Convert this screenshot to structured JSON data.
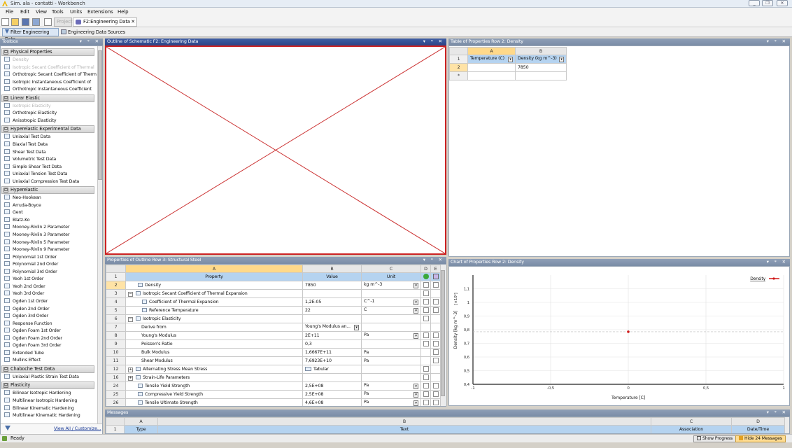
{
  "window": {
    "title": "Sim. ala - contatti - Workbench",
    "buttons": [
      "_",
      "❐",
      "✕"
    ]
  },
  "menu": [
    "File",
    "Edit",
    "View",
    "Tools",
    "Units",
    "Extensions",
    "Help"
  ],
  "tabs": {
    "project": "Project",
    "engineering": "F2:Engineering Data",
    "close": "✕"
  },
  "toolbar2": {
    "filter": "Filter Engineering Data",
    "sources": "Engineering Data Sources"
  },
  "toolbox": {
    "title": "Toolbox",
    "controls": "▾ ᵠ ✕",
    "groups": [
      {
        "label": "Physical Properties",
        "items": [
          {
            "label": "Density",
            "disabled": true
          },
          {
            "label": "Isotropic Secant Coefficient of Thermal",
            "disabled": true
          },
          {
            "label": "Orthotropic Secant Coefficient of Therm",
            "disabled": false
          },
          {
            "label": "Isotropic Instantaneous Coefficient of",
            "disabled": false
          },
          {
            "label": "Orthotropic Instantaneous Coefficient",
            "disabled": false
          }
        ]
      },
      {
        "label": "Linear Elastic",
        "items": [
          {
            "label": "Isotropic Elasticity",
            "disabled": true
          },
          {
            "label": "Orthotropic Elasticity",
            "disabled": false
          },
          {
            "label": "Anisotropic Elasticity",
            "disabled": false
          }
        ]
      },
      {
        "label": "Hyperelastic Experimental Data",
        "items": [
          {
            "label": "Uniaxial Test Data",
            "disabled": false
          },
          {
            "label": "Biaxial Test Data",
            "disabled": false
          },
          {
            "label": "Shear Test Data",
            "disabled": false
          },
          {
            "label": "Volumetric Test Data",
            "disabled": false
          },
          {
            "label": "Simple Shear Test Data",
            "disabled": false
          },
          {
            "label": "Uniaxial Tension Test Data",
            "disabled": false
          },
          {
            "label": "Uniaxial Compression Test Data",
            "disabled": false
          }
        ]
      },
      {
        "label": "Hyperelastic",
        "items": [
          {
            "label": "Neo-Hookean",
            "disabled": false
          },
          {
            "label": "Arruda-Boyce",
            "disabled": false
          },
          {
            "label": "Gent",
            "disabled": false
          },
          {
            "label": "Blatz-Ko",
            "disabled": false
          },
          {
            "label": "Mooney-Rivlin 2 Parameter",
            "disabled": false
          },
          {
            "label": "Mooney-Rivlin 3 Parameter",
            "disabled": false
          },
          {
            "label": "Mooney-Rivlin 5 Parameter",
            "disabled": false
          },
          {
            "label": "Mooney-Rivlin 9 Parameter",
            "disabled": false
          },
          {
            "label": "Polynomial 1st Order",
            "disabled": false
          },
          {
            "label": "Polynomial 2nd Order",
            "disabled": false
          },
          {
            "label": "Polynomial 3rd Order",
            "disabled": false
          },
          {
            "label": "Yeoh 1st Order",
            "disabled": false
          },
          {
            "label": "Yeoh 2nd Order",
            "disabled": false
          },
          {
            "label": "Yeoh 3rd Order",
            "disabled": false
          },
          {
            "label": "Ogden 1st Order",
            "disabled": false
          },
          {
            "label": "Ogden 2nd Order",
            "disabled": false
          },
          {
            "label": "Ogden 3rd Order",
            "disabled": false
          },
          {
            "label": "Response Function",
            "disabled": false
          },
          {
            "label": "Ogden Foam 1st Order",
            "disabled": false
          },
          {
            "label": "Ogden Foam 2nd Order",
            "disabled": false
          },
          {
            "label": "Ogden Foam 3rd Order",
            "disabled": false
          },
          {
            "label": "Extended Tube",
            "disabled": false
          },
          {
            "label": "Mullins Effect",
            "disabled": false
          }
        ]
      },
      {
        "label": "Chaboche Test Data",
        "items": [
          {
            "label": "Uniaxial Plastic Strain Test Data",
            "disabled": false
          }
        ]
      },
      {
        "label": "Plasticity",
        "items": [
          {
            "label": "Bilinear Isotropic Hardening",
            "disabled": false
          },
          {
            "label": "Multilinear Isotropic Hardening",
            "disabled": false
          },
          {
            "label": "Bilinear Kinematic Hardening",
            "disabled": false
          },
          {
            "label": "Multilinear Kinematic Hardening",
            "disabled": false
          }
        ]
      }
    ],
    "view_all": "View All / Customize..."
  },
  "outline": {
    "title": "Outline of Schematic F2: Engineering Data",
    "controls": "▾ ᵠ ✕"
  },
  "table_props": {
    "title": "Table of Properties Row 2: Density",
    "controls": "▾ ᵠ ✕",
    "col_letters": [
      "A",
      "B"
    ],
    "headers": [
      "Temperature (C)",
      "Density (kg m^-3)"
    ],
    "rows": [
      [
        "1",
        "",
        ""
      ],
      [
        "2",
        "",
        "7850"
      ],
      [
        "*",
        "",
        ""
      ]
    ]
  },
  "properties": {
    "title": "Properties of Outline Row 3: Structural Steel",
    "controls": "▾ ᵠ ✕",
    "col_letters": [
      "A",
      "B",
      "C",
      "D",
      "E"
    ],
    "headers": [
      "Property",
      "Value",
      "Unit"
    ],
    "rows": [
      {
        "n": "2",
        "label": "Density",
        "indent": 0,
        "exp": "",
        "icon": true,
        "value": "7850",
        "unit": "kg m^-3",
        "dd": true,
        "d": true,
        "e": true
      },
      {
        "n": "3",
        "label": "Isotropic Secant Coefficient of Thermal Expansion",
        "indent": 0,
        "exp": "⊟",
        "icon": true,
        "value": "",
        "unit": "",
        "dd": false,
        "d": true,
        "e": false
      },
      {
        "n": "4",
        "label": "Coefficient of Thermal Expansion",
        "indent": 1,
        "exp": "",
        "icon": true,
        "value": "1,2E-05",
        "unit": "C^-1",
        "dd": true,
        "d": true,
        "e": true
      },
      {
        "n": "5",
        "label": "Reference Temperature",
        "indent": 1,
        "exp": "",
        "icon": true,
        "value": "22",
        "unit": "C",
        "dd": true,
        "d": true,
        "e": true
      },
      {
        "n": "6",
        "label": "Isotropic Elasticity",
        "indent": 0,
        "exp": "⊟",
        "icon": true,
        "value": "",
        "unit": "",
        "dd": false,
        "d": true,
        "e": false
      },
      {
        "n": "7",
        "label": "Derive from",
        "indent": 1,
        "exp": "",
        "icon": false,
        "value": "Young's Modulus an...",
        "unit": "",
        "dd": false,
        "d": false,
        "e": false,
        "vdd": true
      },
      {
        "n": "8",
        "label": "Young's Modulus",
        "indent": 1,
        "exp": "",
        "icon": false,
        "value": "2E+11",
        "unit": "Pa",
        "dd": true,
        "d": true,
        "e": true
      },
      {
        "n": "9",
        "label": "Poisson's Ratio",
        "indent": 1,
        "exp": "",
        "icon": false,
        "value": "0,3",
        "unit": "",
        "dd": false,
        "d": true,
        "e": true
      },
      {
        "n": "10",
        "label": "Bulk Modulus",
        "indent": 1,
        "exp": "",
        "icon": false,
        "value": "1,6667E+11",
        "unit": "Pa",
        "dd": false,
        "d": false,
        "e": true
      },
      {
        "n": "11",
        "label": "Shear Modulus",
        "indent": 1,
        "exp": "",
        "icon": false,
        "value": "7,6923E+10",
        "unit": "Pa",
        "dd": false,
        "d": false,
        "e": true
      },
      {
        "n": "12",
        "label": "Alternating Stress Mean Stress",
        "indent": 0,
        "exp": "⊞",
        "icon": true,
        "value": "Tabular",
        "unit": "",
        "dd": false,
        "d": true,
        "e": false,
        "vicon": true
      },
      {
        "n": "16",
        "label": "Strain-Life Parameters",
        "indent": 0,
        "exp": "⊞",
        "icon": true,
        "value": "",
        "unit": "",
        "dd": false,
        "d": true,
        "e": false
      },
      {
        "n": "24",
        "label": "Tensile Yield Strength",
        "indent": 0,
        "exp": "",
        "icon": true,
        "value": "2,5E+08",
        "unit": "Pa",
        "dd": true,
        "d": true,
        "e": true
      },
      {
        "n": "25",
        "label": "Compressive Yield Strength",
        "indent": 0,
        "exp": "",
        "icon": true,
        "value": "2,5E+08",
        "unit": "Pa",
        "dd": true,
        "d": true,
        "e": true
      },
      {
        "n": "26",
        "label": "Tensile Ultimate Strength",
        "indent": 0,
        "exp": "",
        "icon": true,
        "value": "4,6E+08",
        "unit": "Pa",
        "dd": true,
        "d": true,
        "e": true
      }
    ]
  },
  "chart_data": {
    "type": "scatter",
    "title": "Chart of Properties Row 2: Density",
    "xlabel": "Temperature [C]",
    "ylabel": "Density [kg m^-3]",
    "yscale_label": "[×10⁴]",
    "xlim": [
      -1,
      1
    ],
    "ylim": [
      0.4,
      1.2
    ],
    "xticks": [
      "-1",
      "-0,5",
      "0",
      "0,5",
      "1"
    ],
    "yticks": [
      "0,4",
      "0,5",
      "0,6",
      "0,7",
      "0,8",
      "0,9",
      "1",
      "1,1"
    ],
    "series": [
      {
        "name": "Density",
        "x": [
          0
        ],
        "y": [
          0.785
        ],
        "color": "#d01919"
      }
    ],
    "legend": "top-right"
  },
  "chart_panel": {
    "controls": "▾ ᵠ ✕"
  },
  "messages": {
    "title": "Messages",
    "controls": "▾ ᵠ ✕",
    "col_letters": [
      "A",
      "B",
      "C",
      "D"
    ],
    "headers": [
      "Type",
      "Text",
      "Association",
      "Date/Time"
    ],
    "row": "1"
  },
  "status": {
    "text": "Ready",
    "progress": "Show Progress",
    "hide": "Hide 24 Messages"
  }
}
